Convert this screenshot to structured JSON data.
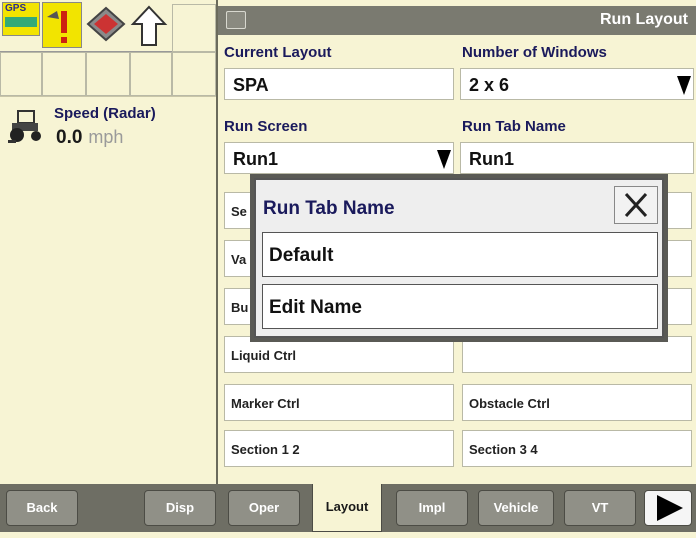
{
  "colors": {
    "panel_bg": "#f7f4d4",
    "title_bar": "#7a7a70",
    "label_text": "#1a1a5c",
    "toolbar_bg": "#6e6e64",
    "gps_yellow": "#f2e400"
  },
  "left_panel": {
    "icons": [
      "gps-icon",
      "warning-icon",
      "book-icon",
      "up-arrow-icon"
    ],
    "gps_text": "GPS",
    "speed_label": "Speed (Radar)",
    "speed_value": "0.0",
    "speed_unit": "mph"
  },
  "header": {
    "title": "Run Layout"
  },
  "form": {
    "current_layout_label": "Current Layout",
    "current_layout_value": "SPA",
    "number_windows_label": "Number of Windows",
    "number_windows_value": "2 x 6",
    "run_screen_label": "Run Screen",
    "run_screen_value": "Run1",
    "run_tab_name_label": "Run Tab Name",
    "run_tab_name_value": "Run1"
  },
  "buttons": {
    "left_partial": [
      "Se",
      "Va",
      "Bu"
    ],
    "liquid": "Liquid Ctrl",
    "marker": "Marker Ctrl",
    "obstacle": "Obstacle Ctrl",
    "section12": "Section 1 2",
    "section34": "Section 3 4"
  },
  "popup": {
    "title": "Run Tab Name",
    "items": [
      "Default",
      "Edit Name"
    ]
  },
  "toolbar": {
    "items": [
      "Back",
      "Disp",
      "Oper",
      "Layout",
      "Impl",
      "Vehicle",
      "VT"
    ],
    "active": "Layout"
  }
}
